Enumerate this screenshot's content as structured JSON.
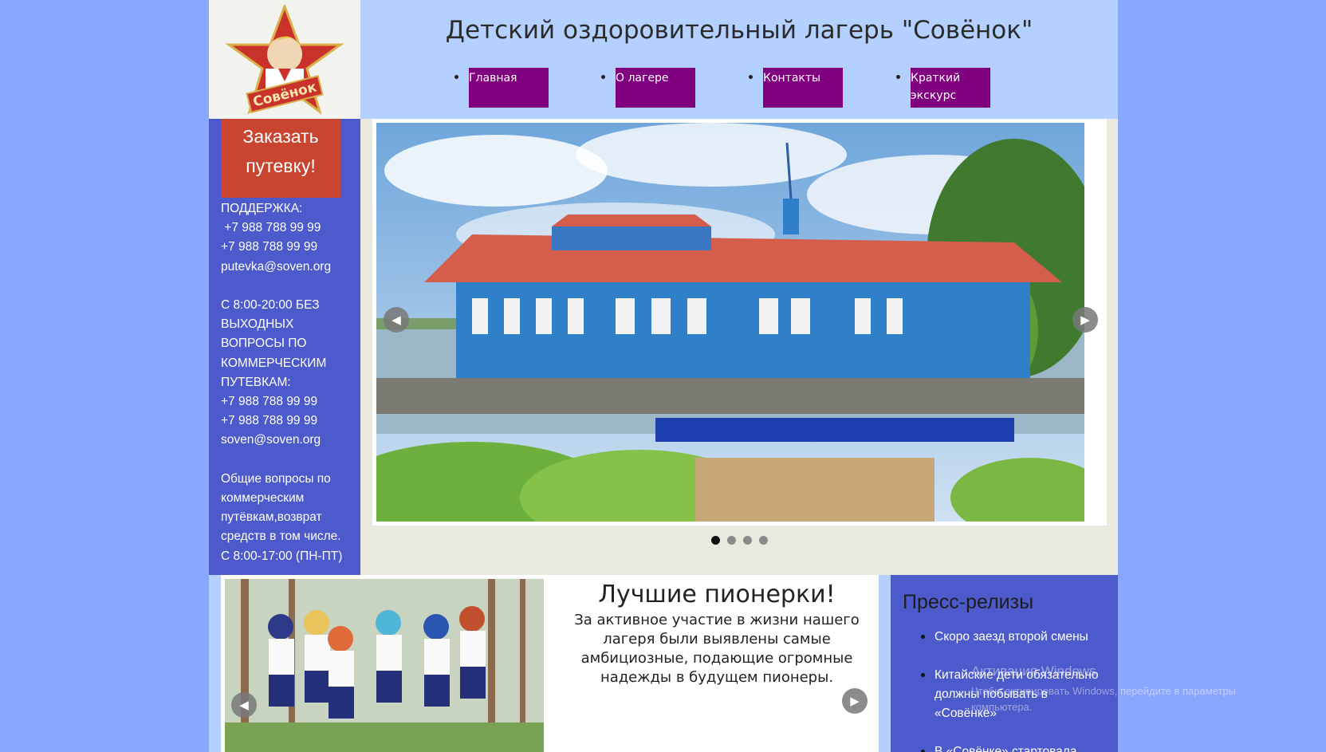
{
  "header": {
    "title": "Детский оздоровительный лагерь \"Совёнок\"",
    "logo_text": "Совёнок",
    "nav": [
      {
        "label": "Главная"
      },
      {
        "label": "О лагере"
      },
      {
        "label": "Контакты"
      },
      {
        "label": "Краткий экскурс"
      }
    ]
  },
  "sidebar": {
    "order_button": "Заказать путевку!",
    "support_lines": [
      "ПОДДЕРЖКА:",
      " +7 988 788 99 99",
      "+7 988 788 99 99",
      "putevka@soven.org",
      "",
      "С 8:00-20:00 БЕЗ",
      "ВЫХОДНЫХ",
      "ВОПРОСЫ ПО",
      "КОММЕРЧЕСКИМ",
      "ПУТЕВКАМ:",
      "+7 988 788 99 99",
      "+7 988 788 99 99",
      "soven@soven.org",
      "",
      "Общие вопросы по",
      "коммерческим",
      "путёвкам,возврат",
      "средств в том числе.",
      "С 8:00-17:00 (ПН-ПТ)"
    ]
  },
  "slider": {
    "prev_icon": "chevron-left-icon",
    "next_icon": "chevron-right-icon",
    "dots_count": 4,
    "active_dot": 0
  },
  "feature": {
    "title": "Лучшие пионерки!",
    "text": "За активное участие в жизни нашего лагеря были выявлены самые амбициозные, подающие огромные надежды в будущем пионеры."
  },
  "press": {
    "title": "Пресс-релизы",
    "items": [
      "Скоро заезд второй смены",
      "Китайские дети обязательно должны побывать в «Совёнке»",
      "В «Совёнке» стартовала"
    ]
  },
  "watermark": {
    "line1": "Активация Windows",
    "line2": "Чтобы активировать Windows, перейдите в параметры компьютера."
  },
  "colors": {
    "background": "#8aa7ff",
    "header_bg": "#b3d0ff",
    "sidebar_bg": "#4c5acb",
    "nav_bg": "#800080",
    "order_button_bg": "#c9452f"
  }
}
